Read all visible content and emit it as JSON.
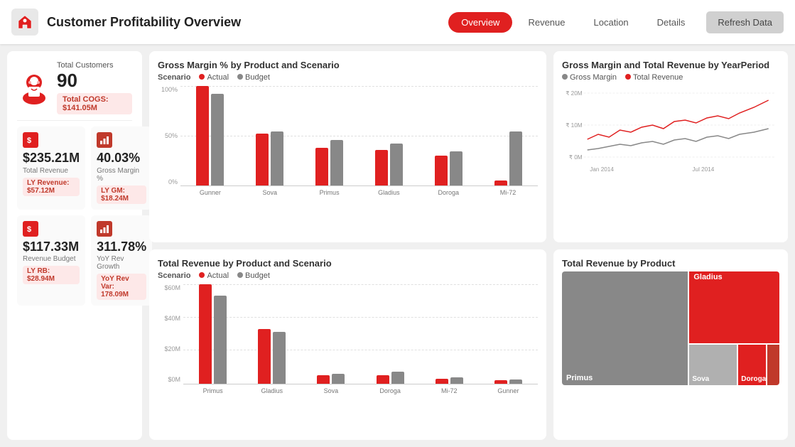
{
  "header": {
    "title": "Customer Profitability Overview",
    "nav": [
      {
        "label": "Overview",
        "active": true
      },
      {
        "label": "Revenue",
        "active": false
      },
      {
        "label": "Location",
        "active": false
      },
      {
        "label": "Details",
        "active": false
      }
    ],
    "refresh_label": "Refresh Data"
  },
  "left": {
    "customers_label": "Total Customers",
    "customers_value": "90",
    "total_cogs": "Total COGS: $141.05M",
    "metrics": [
      {
        "value": "$235.21M",
        "label": "Total Revenue",
        "sub": "LY Revenue: $57.12M",
        "icon_type": "dollar"
      },
      {
        "value": "40.03%",
        "label": "Gross Margin %",
        "sub": "LY GM: $18.24M",
        "icon_type": "bar"
      },
      {
        "value": "$117.33M",
        "label": "Revenue Budget",
        "sub": "LY RB: $28.94M",
        "icon_type": "dollar"
      },
      {
        "value": "311.78%",
        "label": "YoY Rev Growth",
        "sub": "YoY Rev Var: 178.09M",
        "icon_type": "bar"
      }
    ]
  },
  "gross_margin_chart": {
    "title": "Gross Margin % by Product and Scenario",
    "scenario_label": "Scenario",
    "legend": [
      {
        "label": "Actual",
        "color": "#e02020"
      },
      {
        "label": "Budget",
        "color": "#888888"
      }
    ],
    "y_labels": [
      "100%",
      "50%",
      "0%"
    ],
    "products": [
      {
        "name": "Gunner",
        "actual": 100,
        "budget": 92
      },
      {
        "name": "Sova",
        "actual": 52,
        "budget": 54
      },
      {
        "name": "Primus",
        "actual": 38,
        "budget": 46
      },
      {
        "name": "Gladius",
        "actual": 36,
        "budget": 42
      },
      {
        "name": "Doroga",
        "actual": 30,
        "budget": 34
      },
      {
        "name": "Mi-72",
        "actual": 5,
        "budget": 54
      }
    ]
  },
  "revenue_chart": {
    "title": "Total Revenue by Product and Scenario",
    "scenario_label": "Scenario",
    "legend": [
      {
        "label": "Actual",
        "color": "#e02020"
      },
      {
        "label": "Budget",
        "color": "#888888"
      }
    ],
    "y_labels": [
      "$60M",
      "$40M",
      "$20M",
      "$0M"
    ],
    "products": [
      {
        "name": "Primus",
        "actual": 100,
        "budget": 88
      },
      {
        "name": "Gladius",
        "actual": 55,
        "budget": 52
      },
      {
        "name": "Sova",
        "actual": 8,
        "budget": 10
      },
      {
        "name": "Doroga",
        "actual": 8,
        "budget": 12
      },
      {
        "name": "Mi-72",
        "actual": 5,
        "budget": 6
      },
      {
        "name": "Gunner",
        "actual": 3,
        "budget": 4
      }
    ]
  },
  "line_chart": {
    "title": "Gross Margin and Total Revenue by YearPeriod",
    "legend": [
      {
        "label": "Gross Margin",
        "color": "#888888"
      },
      {
        "label": "Total Revenue",
        "color": "#e02020"
      }
    ],
    "y_labels": [
      "₹ 20M",
      "₹ 10M",
      "₹ 0M"
    ],
    "x_labels": [
      "Jan 2014",
      "Jul 2014"
    ]
  },
  "treemap": {
    "title": "Total Revenue by Product",
    "segments": [
      {
        "label": "Primus",
        "color": "#888888"
      },
      {
        "label": "Gladius",
        "color": "#e02020"
      },
      {
        "label": "Sova",
        "color": "#b0b0b0"
      },
      {
        "label": "Doroga",
        "color": "#e02020"
      }
    ]
  }
}
